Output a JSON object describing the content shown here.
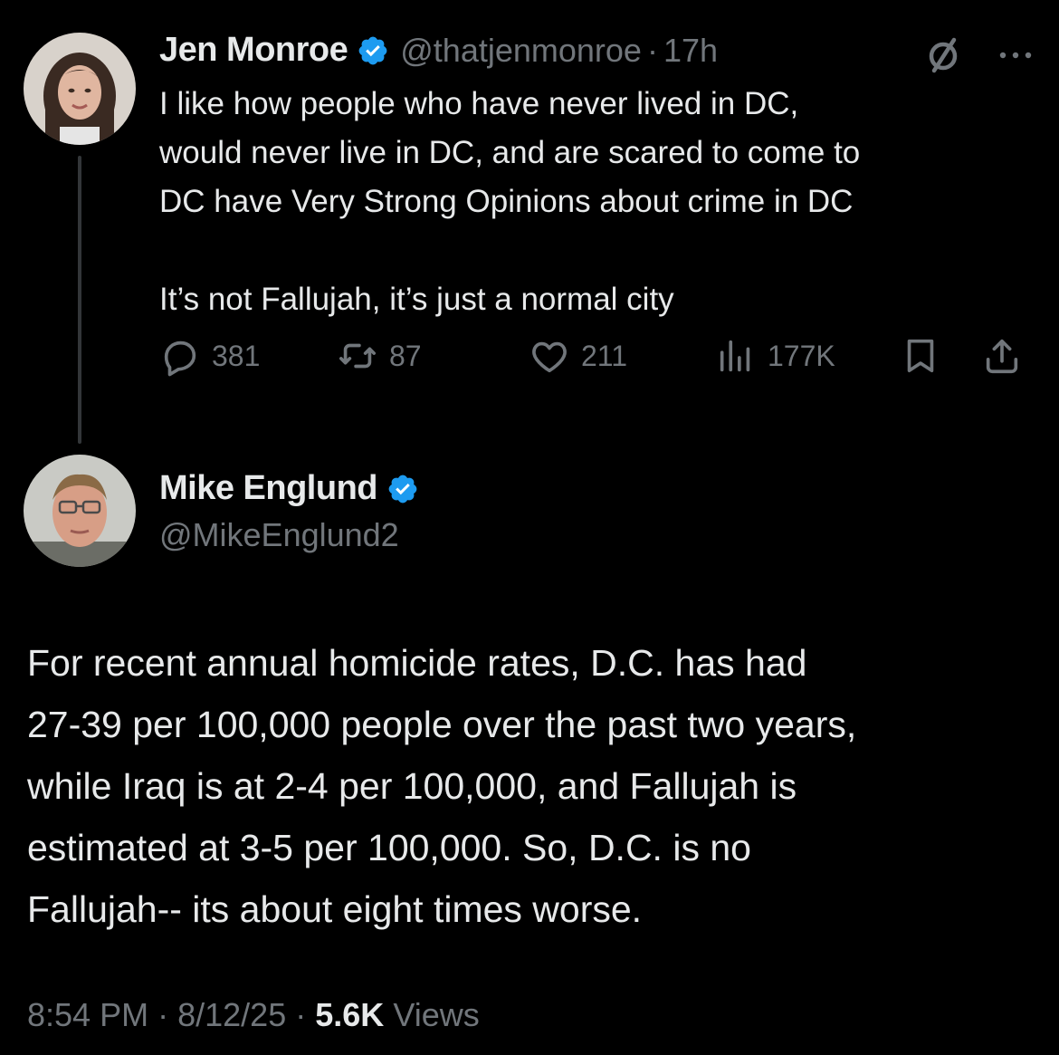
{
  "original_tweet": {
    "author_name": "Jen Monroe",
    "handle": "@thatjenmonroe",
    "separator": "·",
    "time_ago": "17h",
    "text": "I like how people who have never lived in DC,\nwould never live in DC, and are scared to come to\nDC have Very Strong Opinions about crime in DC\n\nIt’s not Fallujah, it’s just a normal city",
    "replies": "381",
    "reposts": "87",
    "likes": "211",
    "views": "177K",
    "icons": {
      "grok": "grok-slash-icon",
      "more": "more-icon",
      "reply": "reply-icon",
      "repost": "repost-icon",
      "like": "heart-icon",
      "views": "views-chart-icon",
      "bookmark": "bookmark-icon",
      "share": "share-icon"
    }
  },
  "reply_tweet": {
    "author_name": "Mike Englund",
    "handle": "@MikeEnglund2",
    "text": "For recent annual homicide rates, D.C. has had\n27-39 per 100,000 people over the past two years,\nwhile Iraq is at 2-4 per 100,000, and Fallujah is\nestimated at 3-5 per 100,000. So, D.C. is no\nFallujah-- its about eight times worse.",
    "time": "8:54 PM",
    "date": "8/12/25",
    "views_count": "5.6K",
    "views_label": "Views"
  },
  "colors": {
    "background": "#000000",
    "text_primary": "#e7e9ea",
    "text_secondary": "#71767b",
    "verified_blue": "#1d9bf0",
    "thread_line": "#333639"
  }
}
